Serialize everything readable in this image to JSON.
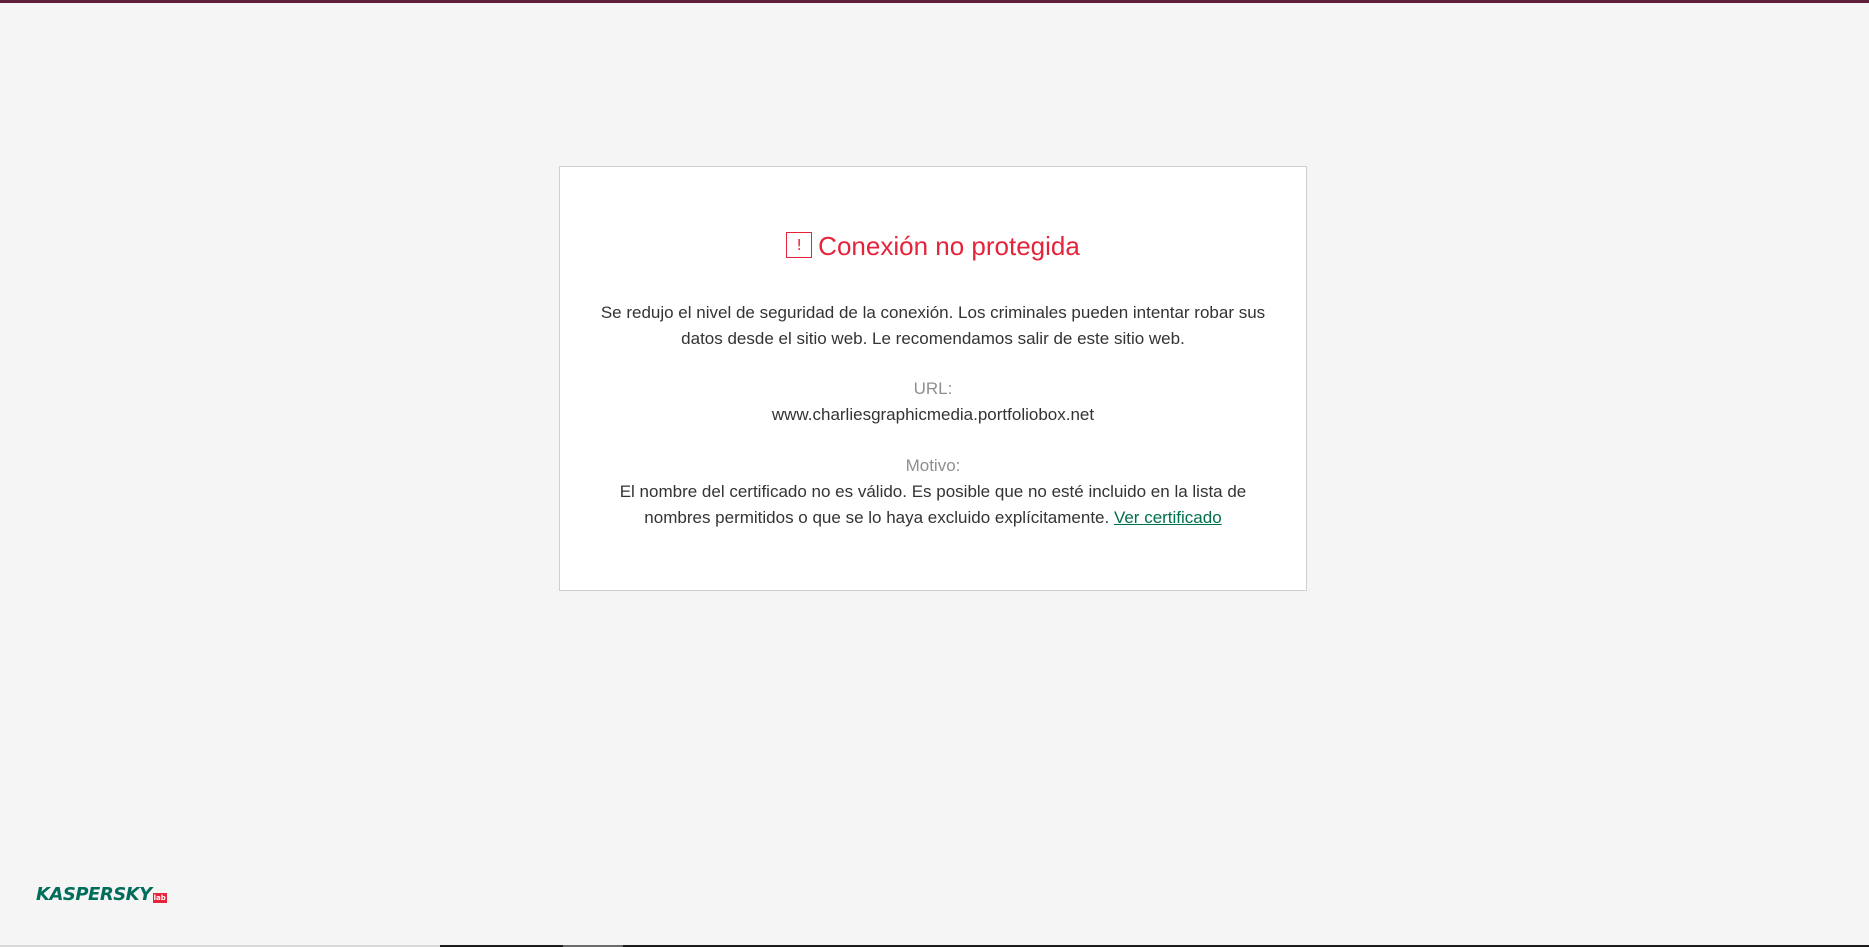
{
  "warning": {
    "icon": "exclamation-square-icon",
    "icon_glyph": "!",
    "title": "Conexión no protegida",
    "description": "Se redujo el nivel de seguridad de la conexión. Los criminales pueden intentar robar sus datos desde el sitio web. Le recomendamos salir de este sitio web.",
    "url_label": "URL:",
    "url_value": "www.charliesgraphicmedia.portfoliobox.net",
    "reason_label": "Motivo:",
    "reason_text": "El nombre del certificado no es válido. Es posible que no esté incluido en la lista de nombres permitidos o que se lo haya excluido explícitamente.",
    "view_certificate_link": "Ver certificado"
  },
  "brand": {
    "logo_text": "KASPERSKY",
    "logo_badge": "lab"
  },
  "colors": {
    "accent_red": "#e5243b",
    "link_green": "#00704a",
    "brand_green": "#006d5b",
    "top_bar": "#5d1f3c",
    "background": "#f5f5f5"
  }
}
